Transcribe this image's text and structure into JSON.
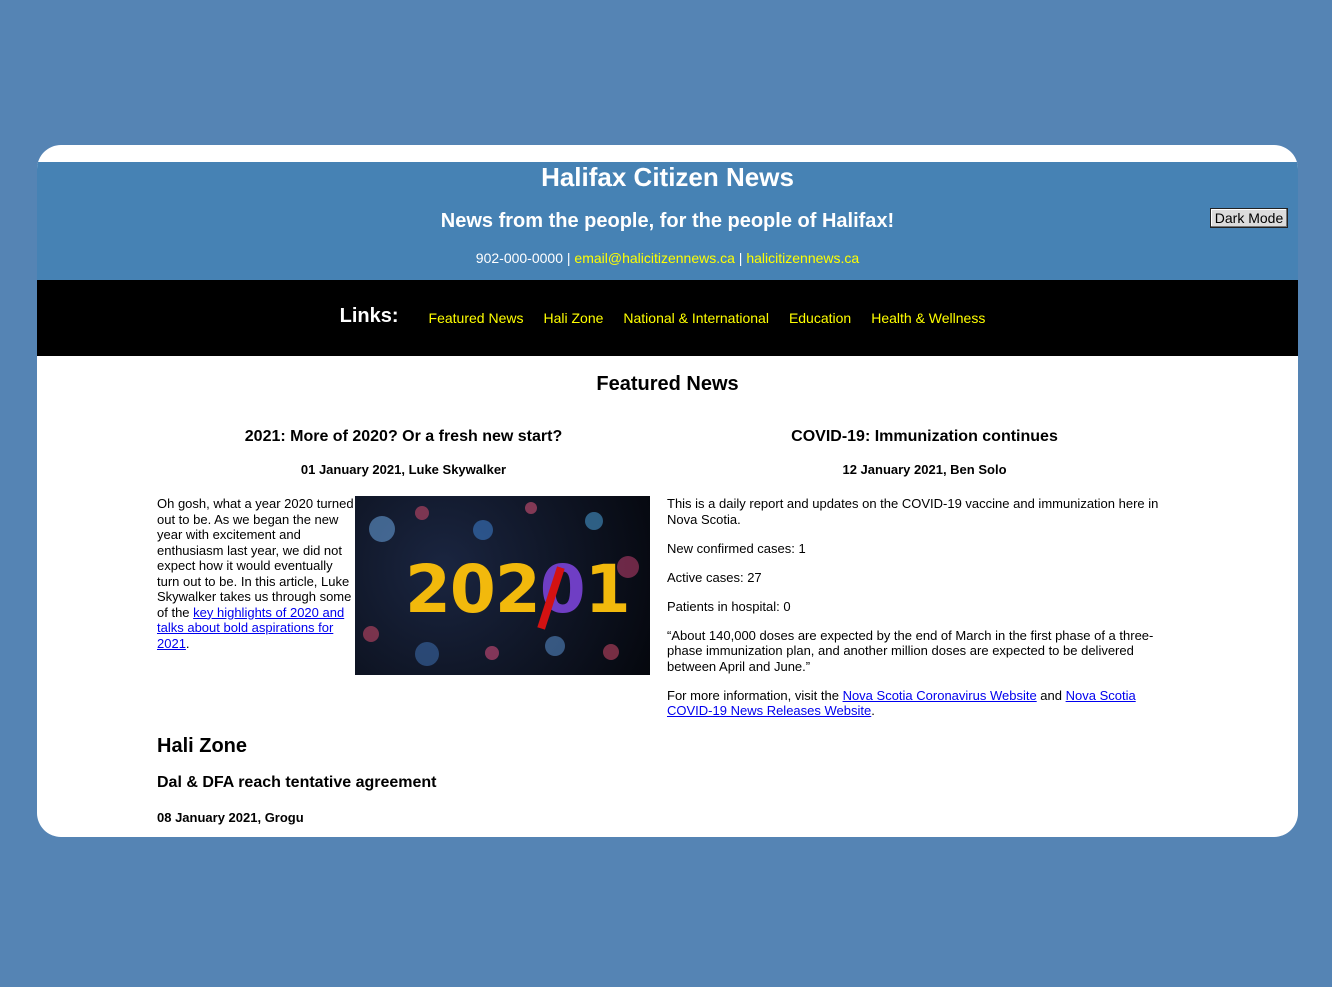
{
  "header": {
    "title": "Halifax Citizen News",
    "tagline": "News from the people, for the people of Halifax!",
    "phone": "902-000-0000",
    "separator": " | ",
    "email": "email@halicitizennews.ca",
    "website": "halicitizennews.ca",
    "dark_mode_label": "Dark Mode"
  },
  "nav": {
    "title": "Links:",
    "items": [
      "Featured News",
      "Hali Zone",
      "National & International",
      "Education",
      "Health & Wellness"
    ]
  },
  "featured": {
    "section_title": "Featured News",
    "article1": {
      "title": "2021: More of 2020? Or a fresh new start?",
      "meta": "01 January 2021, Luke Skywalker",
      "body": "Oh gosh, what a year 2020 turned out to be. As we began the new year with excitement and enthusiasm last year, we did not expect how it would eventually turn out to be. In this article, Luke Skywalker takes us through some of the ",
      "link_text": "key highlights of 2020 and talks about bold aspirations for 2021",
      "end": ".",
      "image": {
        "text_left": "202",
        "text_zero": "0",
        "text_right": "1"
      }
    },
    "article2": {
      "title": "COVID-19: Immunization continues",
      "meta": "12 January 2021, Ben Solo",
      "intro": "This is a daily report and updates on the COVID-19 vaccine and immunization here in Nova Scotia.",
      "new_cases": "New confirmed cases: 1",
      "active_cases": "Active cases: 27",
      "hospital": "Patients in hospital: 0",
      "quote": "“About 140,000 doses are expected by the end of March in the first phase of a three-phase immunization plan, and another million doses are expected to be delivered between April and June.”",
      "more_prefix": "For more information, visit the ",
      "link1": "Nova Scotia Coronavirus Website",
      "and_text": " and ",
      "link2": "Nova Scotia COVID-19 News Releases Website",
      "end": "."
    }
  },
  "hali_zone": {
    "title": "Hali Zone",
    "article_title": "Dal & DFA reach tentative agreement",
    "article_meta": "08 January 2021, Grogu"
  },
  "colors": {
    "page_bg": "#5584b4",
    "header_bg": "#4682b4",
    "nav_bg": "#000000",
    "link_yellow": "#ffff00",
    "link_blue": "#0000ee"
  }
}
